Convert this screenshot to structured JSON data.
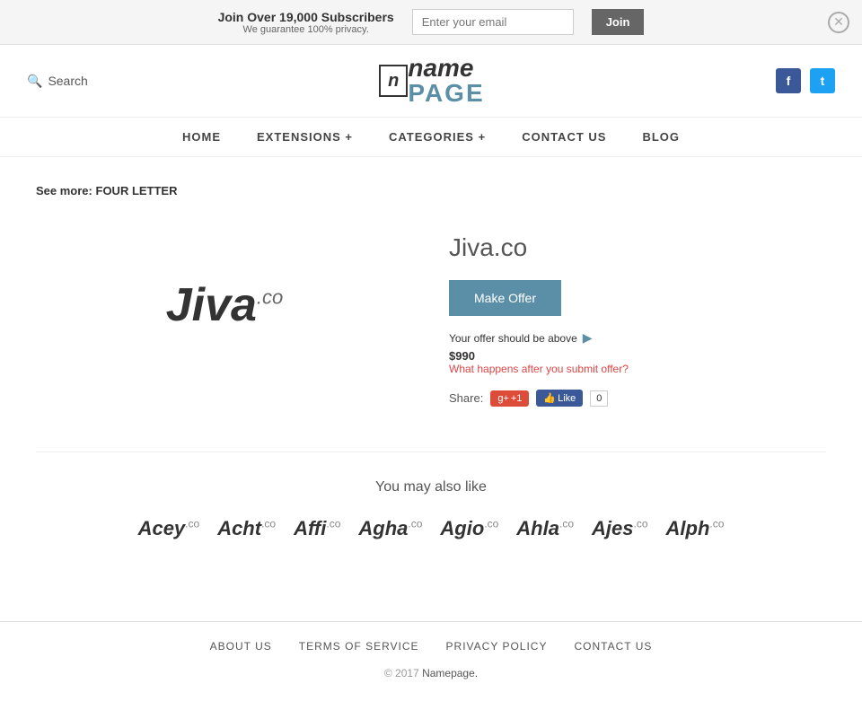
{
  "banner": {
    "main_text": "Join Over 19,000 Subscribers",
    "sub_text": "We guarantee 100% privacy.",
    "email_placeholder": "Enter your email",
    "join_button": "Join"
  },
  "header": {
    "search_label": "Search",
    "logo_icon_text": "n",
    "logo_name": "name",
    "logo_page": "PAGE",
    "social": {
      "facebook": "f",
      "twitter": "t"
    }
  },
  "nav": {
    "items": [
      {
        "label": "HOME",
        "id": "home"
      },
      {
        "label": "EXTENSIONS +",
        "id": "extensions"
      },
      {
        "label": "CATEGORIES +",
        "id": "categories"
      },
      {
        "label": "CONTACT US",
        "id": "contact"
      },
      {
        "label": "BLOG",
        "id": "blog"
      }
    ]
  },
  "see_more": {
    "prefix": "See more:",
    "link_text": "FOUR LETTER"
  },
  "domain": {
    "name": "Jiva.co",
    "logo_main": "Jiva",
    "logo_tld": ".co",
    "make_offer_label": "Make Offer",
    "offer_info": "Your offer should be above",
    "offer_price": "$990",
    "offer_arrow": "▶",
    "what_happens_link": "What happens after you submit offer?",
    "share_label": "Share:",
    "gplus_label": "+1",
    "fb_like_label": "Like",
    "fb_count": "0"
  },
  "also_like": {
    "title": "You may also like",
    "domains": [
      {
        "name": "Acey",
        "tld": ".co"
      },
      {
        "name": "Acht",
        "tld": ".co"
      },
      {
        "name": "Affi",
        "tld": ".co"
      },
      {
        "name": "Agha",
        "tld": ".co"
      },
      {
        "name": "Agio",
        "tld": ".co"
      },
      {
        "name": "Ahla",
        "tld": ".co"
      },
      {
        "name": "Ajes",
        "tld": ".co"
      },
      {
        "name": "Alph",
        "tld": ".co"
      }
    ]
  },
  "footer": {
    "links": [
      {
        "label": "ABOUT US"
      },
      {
        "label": "TERMS OF SERVICE"
      },
      {
        "label": "PRIVACY POLICY"
      },
      {
        "label": "CONTACT US"
      }
    ],
    "copyright": "© 2017 ",
    "brand": "Namepage.",
    "separator": "|"
  }
}
